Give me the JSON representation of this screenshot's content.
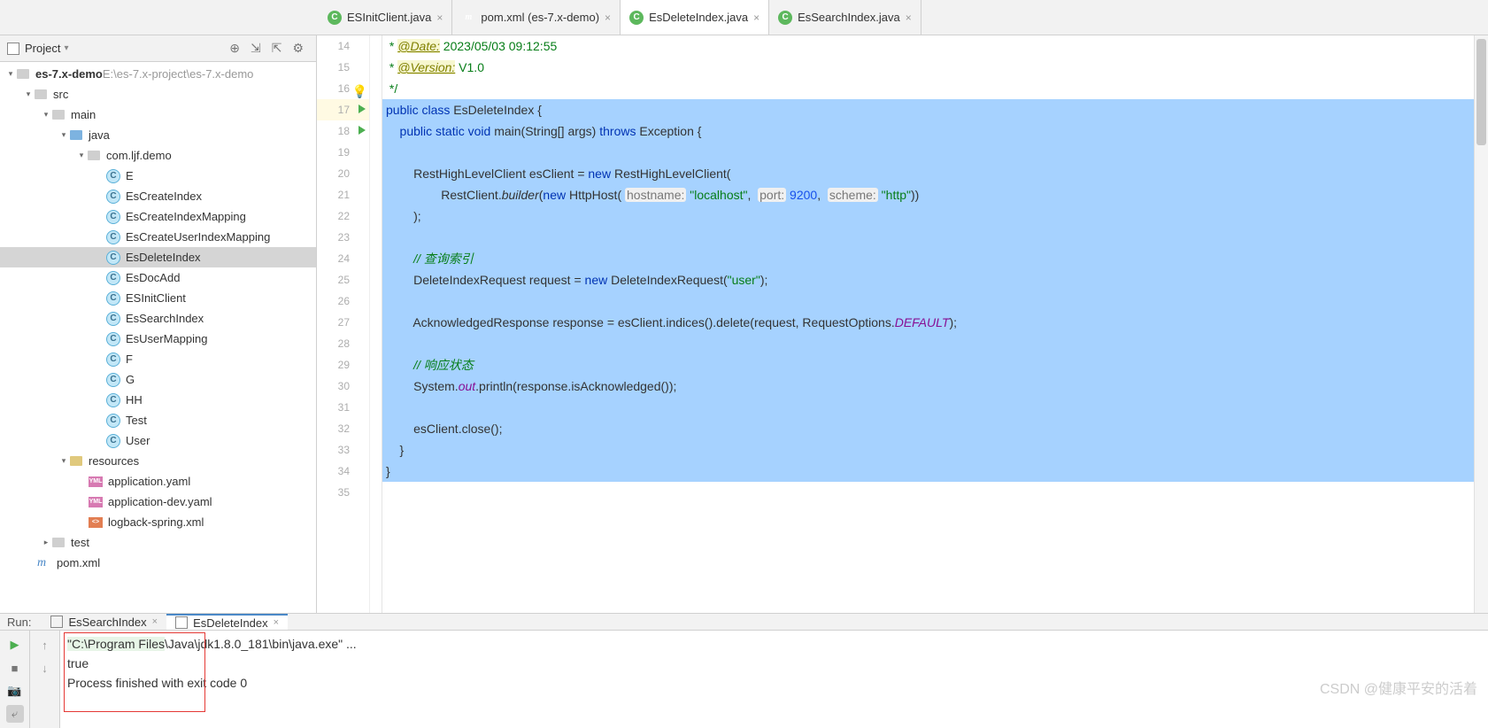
{
  "sidebar": {
    "title": "Project",
    "root": {
      "name": "es-7.x-demo",
      "path": " E:\\es-7.x-project\\es-7.x-demo"
    },
    "src": "src",
    "main": "main",
    "java": "java",
    "pkg": "com.ljf.demo",
    "classes": [
      "E",
      "EsCreateIndex",
      "EsCreateIndexMapping",
      "EsCreateUserIndexMapping",
      "EsDeleteIndex",
      "EsDocAdd",
      "ESInitClient",
      "EsSearchIndex",
      "EsUserMapping",
      "F",
      "G",
      "HH",
      "Test",
      "User"
    ],
    "resources": "resources",
    "res_files": [
      "application.yaml",
      "application-dev.yaml",
      "logback-spring.xml"
    ],
    "test": "test",
    "pom": "pom.xml"
  },
  "tabs": [
    {
      "icon": "c",
      "label": "ESInitClient.java",
      "active": false
    },
    {
      "icon": "m",
      "label": "pom.xml (es-7.x-demo)",
      "active": false
    },
    {
      "icon": "c",
      "label": "EsDeleteIndex.java",
      "active": true
    },
    {
      "icon": "c",
      "label": "EsSearchIndex.java",
      "active": false
    }
  ],
  "code": {
    "n14": "14",
    "n15": "15",
    "n16": "16",
    "n17": "17",
    "n18": "18",
    "n19": "19",
    "n20": "20",
    "n21": "21",
    "n22": "22",
    "n23": "23",
    "n24": "24",
    "n25": "25",
    "n26": "26",
    "n27": "27",
    "n28": "28",
    "n29": "29",
    "n30": "30",
    "n31": "31",
    "n32": "32",
    "n33": "33",
    "n34": "34",
    "n35": "35",
    "l14a": " * ",
    "l14b": "@Date:",
    "l14c": " 2023/05/03 09:12:55",
    "l15a": " * ",
    "l15b": "@Version:",
    "l15c": " V1.0",
    "l16": " */",
    "l17a": "public ",
    "l17b": "class ",
    "l17c": "EsDeleteIndex {",
    "l18a": "    public ",
    "l18b": "static ",
    "l18c": "void ",
    "l18d": "main",
    "l18e": "(String[] args) ",
    "l18f": "throws ",
    "l18g": "Exception {",
    "l20a": "        RestHighLevelClient esClient = ",
    "l20b": "new ",
    "l20c": "RestHighLevelClient(",
    "l21a": "                RestClient.",
    "l21b": "builder",
    "l21c": "(",
    "l21d": "new ",
    "l21e": "HttpHost( ",
    "l21f": "hostname:",
    "l21g": " \"localhost\"",
    "l21h": ",  ",
    "l21i": "port:",
    "l21j": " 9200",
    "l21k": ",  ",
    "l21l": "scheme:",
    "l21m": " \"http\"",
    "l21n": "))",
    "l22": "        );",
    "l24a": "        ",
    "l24b": "// 查询索引",
    "l25a": "        DeleteIndexRequest request = ",
    "l25b": "new ",
    "l25c": "DeleteIndexRequest(",
    "l25d": "\"user\"",
    "l25e": ");",
    "l27a": "        AcknowledgedResponse response = esClient.indices().delete(request, RequestOptions.",
    "l27b": "DEFAULT",
    "l27c": ");",
    "l29a": "        ",
    "l29b": "// 响应状态",
    "l30a": "        System.",
    "l30b": "out",
    "l30c": ".println(response.isAcknowledged());",
    "l32": "        esClient.close();",
    "l33": "    }",
    "l34": "}"
  },
  "run": {
    "label": "Run:",
    "tabs": [
      {
        "label": "EsSearchIndex",
        "active": false
      },
      {
        "label": "EsDeleteIndex",
        "active": true
      }
    ],
    "line1a": "\"C:\\Program Files",
    "line1b": "\\Java\\jdk1.8.0_181\\bin\\java.exe\" ...",
    "line2": "true",
    "line3": "",
    "line4": "Process finished with exit code 0"
  },
  "watermark": "CSDN @健康平安的活着"
}
